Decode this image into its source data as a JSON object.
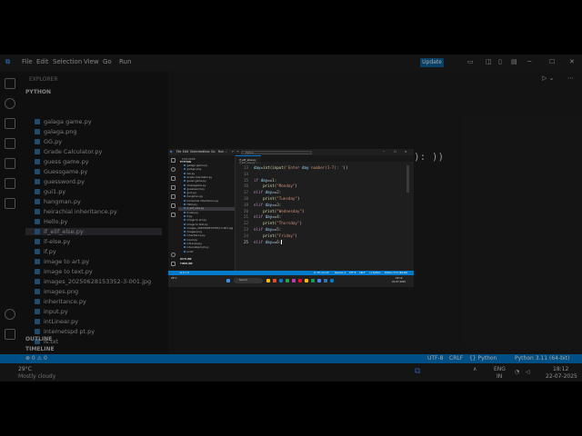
{
  "background": {
    "menu": [
      "File",
      "Edit",
      "Selection",
      "View",
      "Go",
      "Run"
    ],
    "update_label": "Update",
    "sidebar_title": "EXPLORER",
    "folder": "PYTHON",
    "files": [
      "galaga game.py",
      "galaga.png",
      "GG.py",
      "Grade Calculator.py",
      "guess game.py",
      "Guessgame.py",
      "guessword.py",
      "gui1.py",
      "hangman.py",
      "heirachial inheritance.py",
      "Hello.py",
      "if_elif_else.py",
      "if-else.py",
      "if.py",
      "image to art.py",
      "image to text.py",
      "images_20250628153352-3-001.jpg",
      "images.png",
      "inheritance.py",
      "input.py",
      "intLinear.py",
      "internetspd pt.py",
      "is.txt"
    ],
    "selected_file": "if_elif_else.py",
    "sections": [
      "OUTLINE",
      "TIMELINE"
    ],
    "code_fragment": "): ))",
    "status_left": "⊗ 0 ⚠ 0",
    "status_right": [
      "UTF-8",
      "CRLF",
      "{} Python",
      "Python 3.11 (64-bit)"
    ],
    "weather": "29°C",
    "weather_desc": "Mostly cloudy",
    "lang": "ENG",
    "lang2": "IN",
    "time": "18:12",
    "date": "22-07-2025"
  },
  "window": {
    "menu": [
      "File",
      "Edit",
      "Selection",
      "View",
      "Go",
      "Run"
    ],
    "search_placeholder": "Python",
    "sidebar_title": "EXPLORER",
    "folder": "PYTHON",
    "files": [
      "galaga game.py",
      "galaga.png",
      "GG.py",
      "Grade Calculator.py",
      "guess game.py",
      "Guessgame.py",
      "guessword.py",
      "gui1.py",
      "hangman.py",
      "heirachial inheritance.py",
      "Hello.py",
      "if_elif_else.py",
      "if-else.py",
      "if.py",
      "image to art.py",
      "image to text.py",
      "images_20250628153352-3-001.jpg",
      "images.png",
      "inheritance.py",
      "input.py",
      "intLinear.py",
      "internetspd pt.py",
      "is.txt"
    ],
    "selected_index": 11,
    "sections": [
      "OUTLINE",
      "TIMELINE"
    ],
    "tab_label": "if_elif_else.py",
    "breadcrumb": "if_elif_else.py > ...",
    "code_lines": [
      {
        "n": "13",
        "text": "day=int(input('Enter day number(1-7): '))"
      },
      {
        "n": "14",
        "text": ""
      },
      {
        "n": "15",
        "text": "if day==1:"
      },
      {
        "n": "16",
        "text": "    print(\"Monday\")"
      },
      {
        "n": "17",
        "text": "elif day==2:"
      },
      {
        "n": "18",
        "text": "    print(\"Tuesday\")"
      },
      {
        "n": "19",
        "text": "elif day==3:"
      },
      {
        "n": "20",
        "text": "    print(\"Wednesday\")"
      },
      {
        "n": "21",
        "text": "elif day==4:"
      },
      {
        "n": "22",
        "text": "    print(\"Thursday\")"
      },
      {
        "n": "23",
        "text": "elif day==5:"
      },
      {
        "n": "24",
        "text": "    print(\"Friday\")"
      },
      {
        "n": "25",
        "text": "elif day==6:"
      }
    ],
    "status_items": [
      "⊗ 0 ⚠ 0",
      "Ln 25, Col 13",
      "Spaces: 4",
      "UTF-8",
      "CRLF",
      "{} Python",
      "Python 3.11 (64-bit)"
    ],
    "taskbar_search": "Search",
    "weather": "29°C",
    "time": "18:12",
    "date": "22-07-2025"
  }
}
